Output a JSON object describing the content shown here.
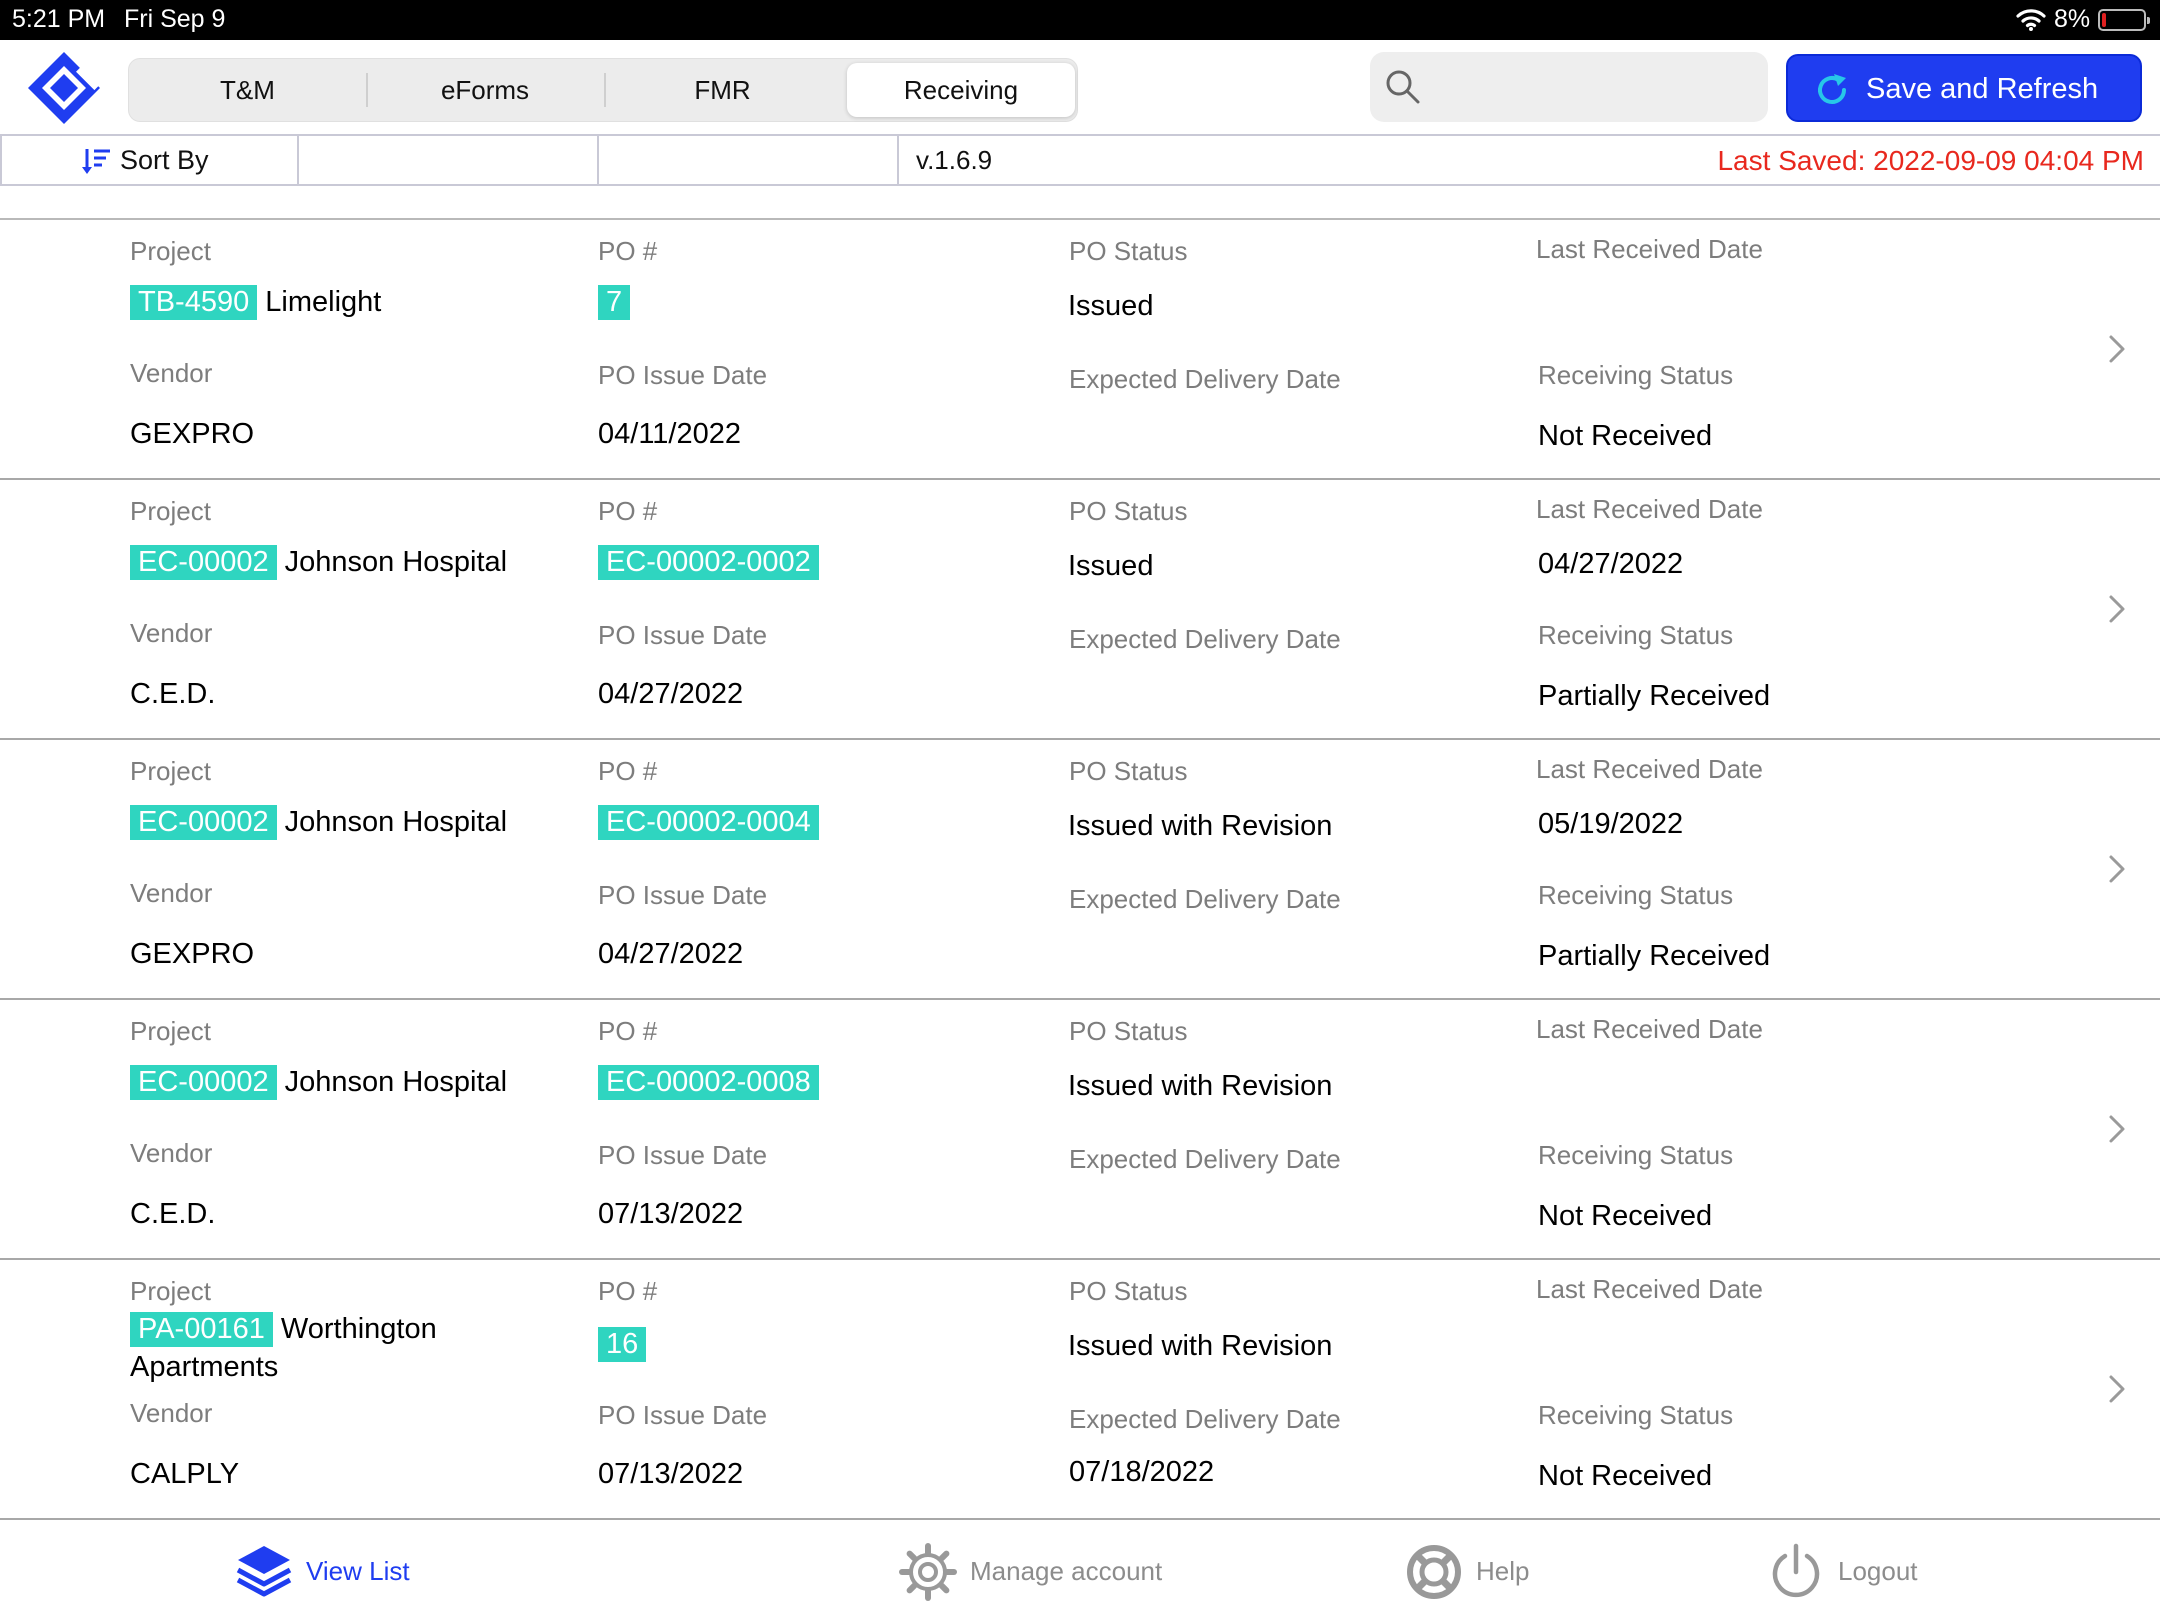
{
  "status_bar": {
    "time": "5:21 PM",
    "date": "Fri Sep 9",
    "battery": "8%"
  },
  "colors": {
    "accent": "#1f3df0",
    "tag": "#2fd5c0",
    "warning": "#e8281e"
  },
  "header": {
    "tabs": [
      {
        "label": "T&M"
      },
      {
        "label": "eForms"
      },
      {
        "label": "FMR"
      },
      {
        "label": "Receiving",
        "selected": true
      }
    ],
    "search_placeholder": "",
    "save_label": "Save and Refresh"
  },
  "toolbar": {
    "sort_label": "Sort By",
    "version": "v.1.6.9",
    "last_saved": "Last Saved: 2022-09-09 04:04 PM"
  },
  "labels": {
    "project": "Project",
    "po_number": "PO #",
    "po_status": "PO Status",
    "last_received": "Last Received Date",
    "vendor": "Vendor",
    "po_issue_date": "PO Issue Date",
    "expected_delivery": "Expected Delivery Date",
    "receiving_status": "Receiving Status"
  },
  "rows": [
    {
      "project_code": "TB-4590",
      "project_name": "Limelight",
      "po_number": "7",
      "po_status": "Issued",
      "last_received": "",
      "vendor": "GEXPRO",
      "po_issue_date": "04/11/2022",
      "expected_delivery": "",
      "receiving_status": "Not Received"
    },
    {
      "project_code": "EC-00002",
      "project_name": "Johnson Hospital",
      "po_number": "EC-00002-0002",
      "po_status": "Issued",
      "last_received": "04/27/2022",
      "vendor": "C.E.D.",
      "po_issue_date": "04/27/2022",
      "expected_delivery": "",
      "receiving_status": "Partially Received"
    },
    {
      "project_code": "EC-00002",
      "project_name": "Johnson Hospital",
      "po_number": "EC-00002-0004",
      "po_status": "Issued with Revision",
      "last_received": "05/19/2022",
      "vendor": "GEXPRO",
      "po_issue_date": "04/27/2022",
      "expected_delivery": "",
      "receiving_status": "Partially Received"
    },
    {
      "project_code": "EC-00002",
      "project_name": "Johnson Hospital",
      "po_number": "EC-00002-0008",
      "po_status": "Issued with Revision",
      "last_received": "",
      "vendor": "C.E.D.",
      "po_issue_date": "07/13/2022",
      "expected_delivery": "",
      "receiving_status": "Not Received"
    },
    {
      "project_code": "PA-00161",
      "project_name": "Worthington Apartments",
      "po_number": "16",
      "po_status": "Issued with Revision",
      "last_received": "",
      "vendor": "CALPLY",
      "po_issue_date": "07/13/2022",
      "expected_delivery": "07/18/2022",
      "receiving_status": "Not Received"
    }
  ],
  "bottom_nav": [
    {
      "label": "View List",
      "icon": "layers-icon",
      "active": true
    },
    {
      "label": "Manage account",
      "icon": "gear-icon"
    },
    {
      "label": "Help",
      "icon": "lifebuoy-icon"
    },
    {
      "label": "Logout",
      "icon": "power-icon"
    }
  ]
}
